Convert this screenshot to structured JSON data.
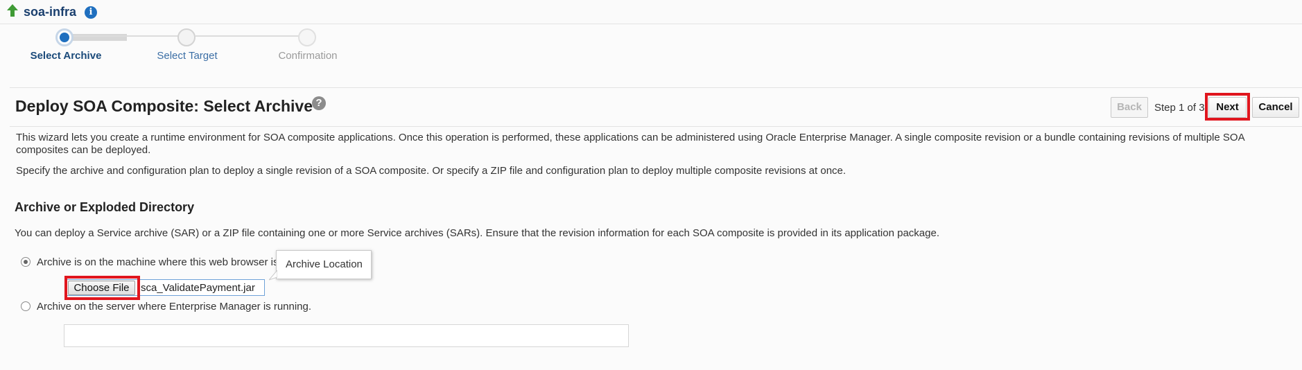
{
  "header": {
    "app_title": "soa-infra",
    "up_icon": "up-arrow-icon",
    "info_icon": "info-icon",
    "info_glyph": "i"
  },
  "train": {
    "steps": [
      {
        "label": "Select Archive",
        "state": "current"
      },
      {
        "label": "Select Target",
        "state": "upcoming"
      },
      {
        "label": "Confirmation",
        "state": "disabled"
      }
    ]
  },
  "page": {
    "title": "Deploy SOA Composite: Select Archive",
    "help_glyph": "?"
  },
  "toolbar": {
    "back_label": "Back",
    "step_text": "Step 1 of 3",
    "next_label": "Next",
    "cancel_label": "Cancel"
  },
  "intro": {
    "line1": "This wizard lets you create a runtime environment for SOA composite applications. Once this operation is performed, these applications can be administered using Oracle Enterprise Manager. A single composite revision or a bundle containing revisions of multiple SOA",
    "line2": "composites can be deployed.",
    "line3": "Specify the archive and configuration plan to deploy a single revision of a SOA composite. Or specify a ZIP file and configuration plan to deploy multiple composite revisions at once."
  },
  "archive_section": {
    "title": "Archive or Exploded Directory",
    "description": "You can deploy a Service archive (SAR) or a ZIP file containing one or more Service archives (SARs). Ensure that the revision information for each SOA composite is provided in its application package.",
    "option_local_label": "Archive is on the machine where this web browser is",
    "option_server_label": "Archive on the server where Enterprise Manager is running.",
    "choose_file_label": "Choose File",
    "file_name": "sca_ValidatePayment.jar",
    "tooltip": "Archive Location",
    "server_path_value": "",
    "selected_option": "local"
  },
  "colors": {
    "highlight": "#e0161e",
    "train_active": "#1f6fbf",
    "link_blue": "#1a3f6e"
  }
}
